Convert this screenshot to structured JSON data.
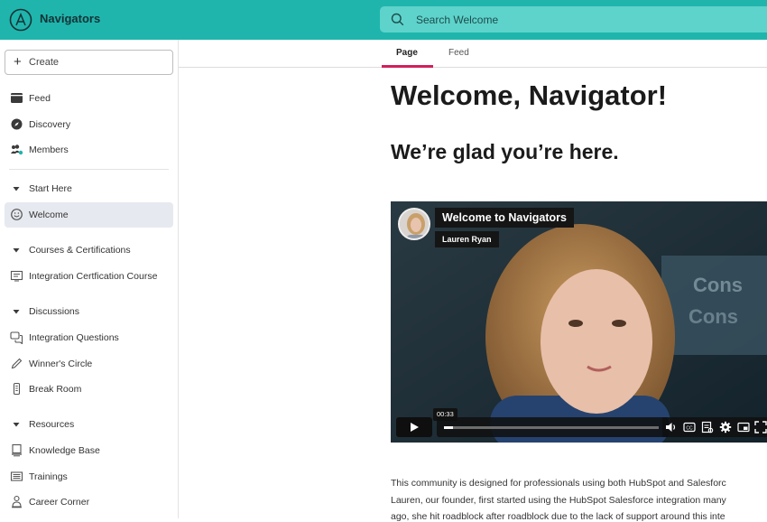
{
  "header": {
    "brand": "Navigators",
    "search_placeholder": "Search Welcome",
    "colors": {
      "bar": "#1fb5ad",
      "search": "#5ed3cb"
    }
  },
  "sidebar": {
    "create_label": "Create",
    "items": [
      {
        "label": "Feed",
        "icon": "feed-icon"
      },
      {
        "label": "Discovery",
        "icon": "compass-icon"
      },
      {
        "label": "Members",
        "icon": "members-icon"
      },
      {
        "label": "Start Here",
        "icon": "caret-down-icon"
      },
      {
        "label": "Welcome",
        "icon": "smile-icon"
      },
      {
        "label": "Courses & Certifications",
        "icon": "caret-down-icon"
      },
      {
        "label": "Integration Certfication Course",
        "icon": "course-icon"
      },
      {
        "label": "Discussions",
        "icon": "caret-down-icon"
      },
      {
        "label": "Integration Questions",
        "icon": "chat-icon"
      },
      {
        "label": "Winner's Circle",
        "icon": "pen-icon"
      },
      {
        "label": "Break Room",
        "icon": "phone-icon"
      },
      {
        "label": "Resources",
        "icon": "caret-down-icon"
      },
      {
        "label": "Knowledge Base",
        "icon": "book-icon"
      },
      {
        "label": "Trainings",
        "icon": "training-icon"
      },
      {
        "label": "Career Corner",
        "icon": "person-icon"
      }
    ]
  },
  "tabs": [
    {
      "label": "Page",
      "active": true
    },
    {
      "label": "Feed",
      "active": false
    }
  ],
  "page": {
    "title": "Welcome, Navigator!",
    "subtitle": "We’re glad you’re here.",
    "paragraph_lines": [
      "This community is designed for professionals using both HubSpot and Salesforc",
      "Lauren, our founder, first started using the HubSpot Salesforce integration many",
      "ago, she hit roadblock after roadblock due to the lack of support around this inte"
    ]
  },
  "video": {
    "title": "Welcome to Navigators",
    "author": "Lauren Ryan",
    "hover_time": "00:33",
    "progress": 0.04,
    "controls": [
      "play-icon",
      "volume-icon",
      "captions-icon",
      "transcript-icon",
      "settings-icon",
      "pip-icon",
      "fullscreen-icon"
    ]
  }
}
